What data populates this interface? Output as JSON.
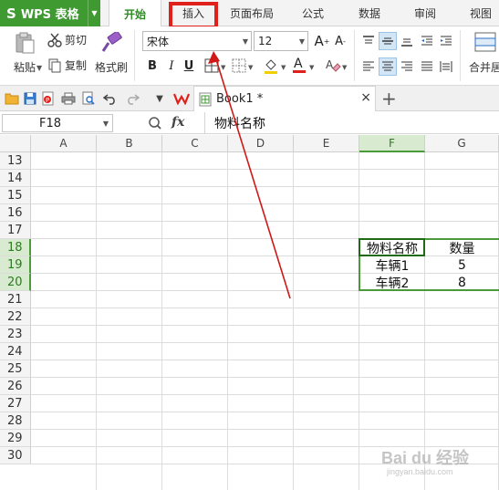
{
  "app": {
    "logo": "S",
    "name": "WPS 表格"
  },
  "menu": {
    "tabs": [
      "开始",
      "插入",
      "页面布局",
      "公式",
      "数据",
      "审阅",
      "视图"
    ],
    "active": "开始",
    "highlighted": "插入"
  },
  "ribbon": {
    "paste": "粘贴",
    "cut": "剪切",
    "copy": "复制",
    "format_painter": "格式刷",
    "font_name": "宋体",
    "font_size": "12",
    "bold": "B",
    "italic": "I",
    "underline": "U",
    "grow_font": "A",
    "shrink_font": "A",
    "merge_center": "合并居"
  },
  "quick_access": {
    "doc_tab": "Book1 *",
    "close": "×",
    "add": "+"
  },
  "formula_bar": {
    "name_box": "F18",
    "fx": "fx",
    "content": "物料名称"
  },
  "sheet": {
    "columns": [
      "A",
      "B",
      "C",
      "D",
      "E",
      "F",
      "G"
    ],
    "selected_column": "F",
    "rows": [
      "13",
      "14",
      "15",
      "16",
      "17",
      "18",
      "19",
      "20",
      "21",
      "22",
      "23",
      "24",
      "25",
      "26",
      "27",
      "28",
      "29",
      "30"
    ],
    "selected_rows": [
      "18",
      "19",
      "20"
    ],
    "table": {
      "header": [
        "物料名称",
        "数量"
      ],
      "rows": [
        [
          "车辆1",
          "5"
        ],
        [
          "车辆2",
          "8"
        ]
      ]
    }
  },
  "colors": {
    "app_green": "#3f9a31",
    "active_tab": "#2e8b22",
    "highlight_red": "#e0201a",
    "arrow_red": "#d11818",
    "selection_green": "#4a9a3a"
  },
  "watermark": {
    "main": "Bai du 经验",
    "sub": "jingyan.baidu.com"
  }
}
